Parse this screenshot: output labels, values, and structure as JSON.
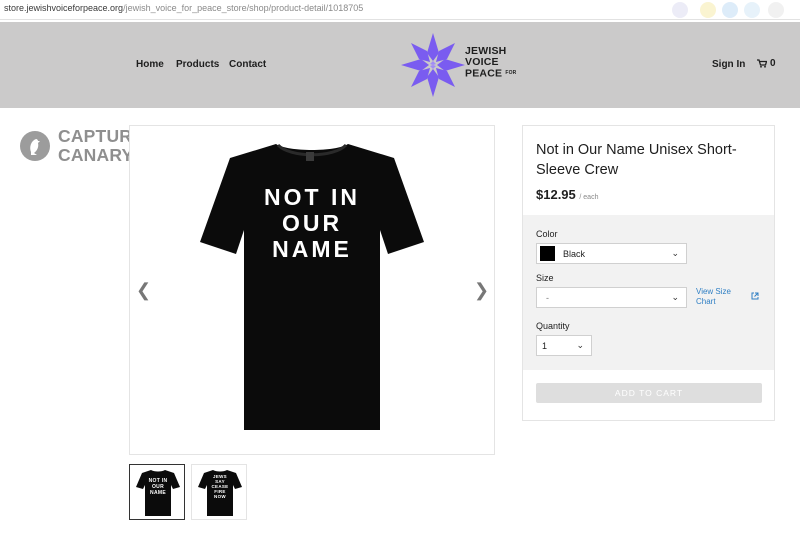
{
  "browser": {
    "url_host": "store.jewishvoiceforpeace.org",
    "url_path": "/jewish_voice_for_peace_store/shop/product-detail/1018705"
  },
  "header": {
    "nav": [
      "Home",
      "Products",
      "Contact"
    ],
    "logo_lines": [
      "JEWISH",
      "VOICE",
      "PEACE"
    ],
    "logo_small": "FOR",
    "sign_in": "Sign In",
    "cart_count": "0"
  },
  "watermark": {
    "line1": "CAPTURED BY",
    "line2": "CANARY MISSION"
  },
  "gallery": {
    "main_shirt_lines": [
      "NOT IN",
      "OUR",
      "NAME"
    ],
    "thumbs": [
      {
        "lines": [
          "NOT IN",
          "OUR",
          "NAME"
        ]
      },
      {
        "lines": [
          "JEWS",
          "SAY",
          "CEASE",
          "FIRE",
          "NOW"
        ]
      }
    ]
  },
  "product": {
    "title": "Not in Our Name Unisex Short-Sleeve Crew",
    "price": "$12.95",
    "price_unit": "/ each",
    "color_label": "Color",
    "color_value": "Black",
    "size_label": "Size",
    "size_value": "-",
    "size_chart_link": "View Size Chart",
    "quantity_label": "Quantity",
    "quantity_value": "1",
    "add_to_cart": "ADD TO CART"
  },
  "colors": {
    "header_bg": "#cbcaca",
    "logo_purple": "#7a5cf0",
    "link_blue": "#2f7fc4"
  }
}
